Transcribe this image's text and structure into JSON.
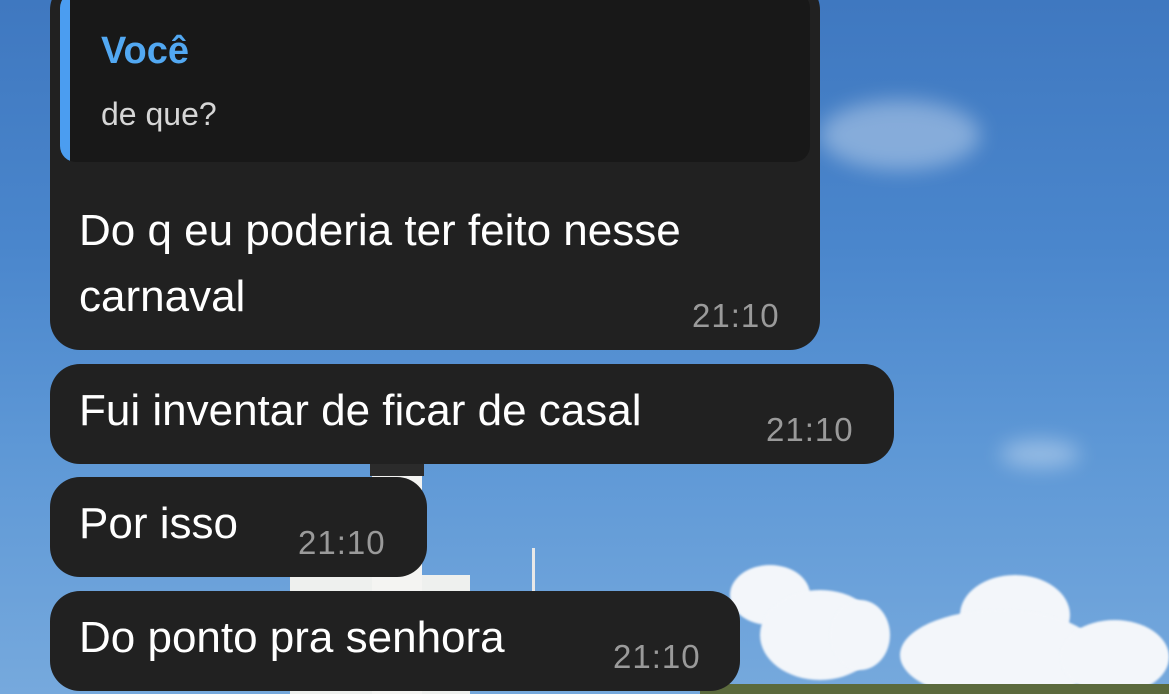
{
  "messages": [
    {
      "reply_to": {
        "author": "Você",
        "text": "de que?"
      },
      "text_lines": [
        "Do q eu poderia ter feito nesse",
        "carnaval"
      ],
      "time": "21:10"
    },
    {
      "text": "Fui inventar de ficar de casal",
      "time": "21:10"
    },
    {
      "text": "Por isso",
      "time": "21:10"
    },
    {
      "text": "Do ponto pra senhora",
      "time": "21:10"
    }
  ],
  "colors": {
    "bubble": "#212121",
    "quote_accent": "#4b9df0",
    "timestamp": "#9a9a9a",
    "sky": "#4a86cc"
  }
}
